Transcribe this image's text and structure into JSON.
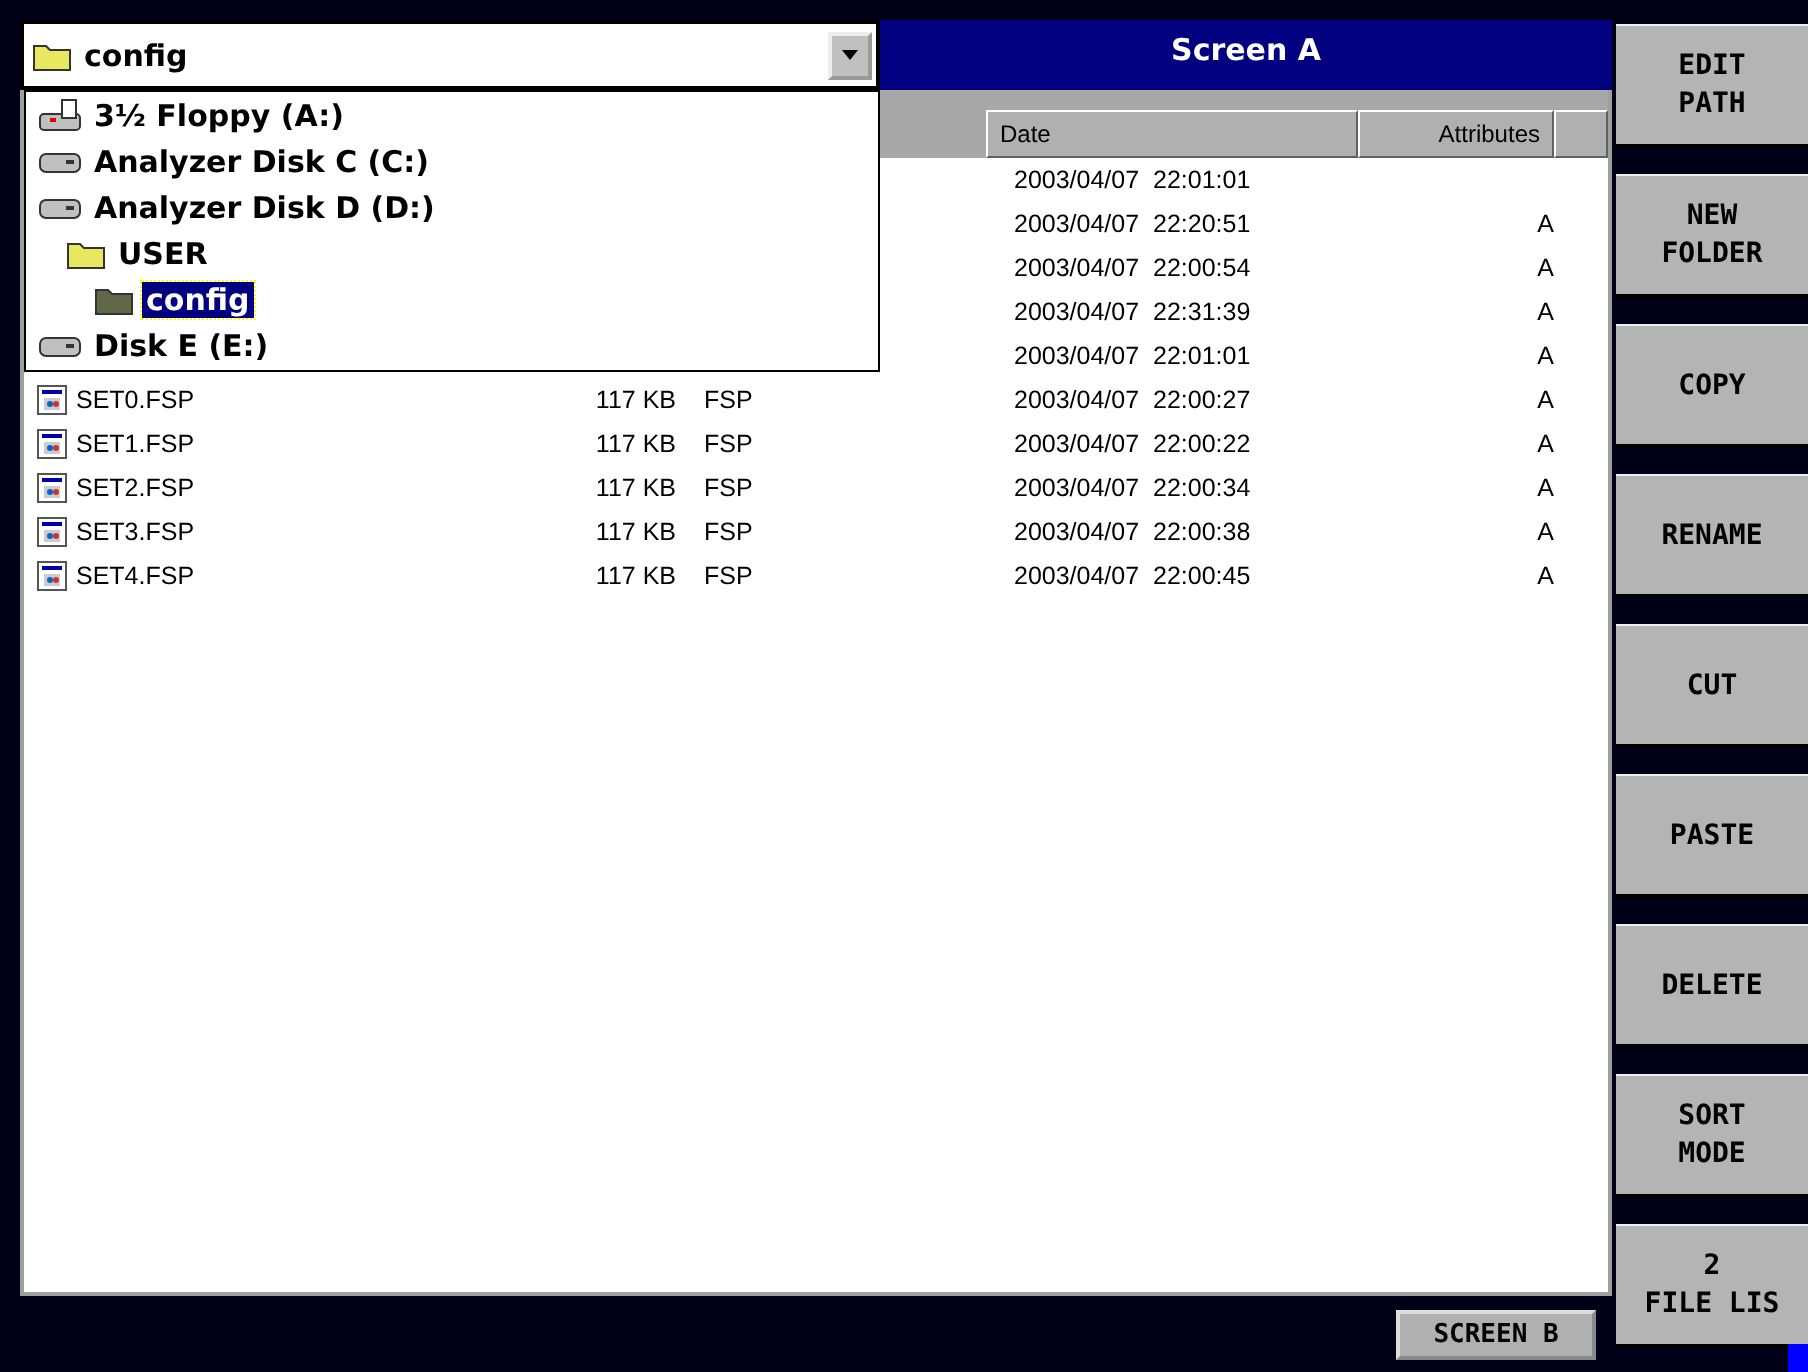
{
  "path_box": {
    "value": "config"
  },
  "title": "Screen A",
  "drive_list": [
    {
      "label": "3½ Floppy (A:)",
      "kind": "floppy",
      "selected": false
    },
    {
      "label": "Analyzer Disk C (C:)",
      "kind": "disk",
      "selected": false
    },
    {
      "label": "Analyzer Disk D (D:)",
      "kind": "disk",
      "selected": false,
      "children": [
        {
          "label": "USER",
          "kind": "folder",
          "selected": false,
          "children": [
            {
              "label": "config",
              "kind": "folder",
              "selected": true
            }
          ]
        }
      ]
    },
    {
      "label": "Disk E (E:)",
      "kind": "disk",
      "selected": false
    }
  ],
  "table": {
    "columns": [
      "Date",
      "Attributes"
    ],
    "rows": [
      {
        "date": "2003/04/07  22:01:01"
      },
      {
        "date": "2003/04/07  22:20:51",
        "attributes": "A"
      },
      {
        "date": "2003/04/07  22:00:54",
        "attributes": "A"
      },
      {
        "date": "2003/04/07  22:31:39",
        "attributes": "A"
      },
      {
        "date": "2003/04/07  22:01:01",
        "attributes": "A"
      },
      {
        "name": "SET0.FSP",
        "size": "117 KB",
        "type": "FSP",
        "date": "2003/04/07  22:00:27",
        "attributes": "A"
      },
      {
        "name": "SET1.FSP",
        "size": "117 KB",
        "type": "FSP",
        "date": "2003/04/07  22:00:22",
        "attributes": "A"
      },
      {
        "name": "SET2.FSP",
        "size": "117 KB",
        "type": "FSP",
        "date": "2003/04/07  22:00:34",
        "attributes": "A"
      },
      {
        "name": "SET3.FSP",
        "size": "117 KB",
        "type": "FSP",
        "date": "2003/04/07  22:00:38",
        "attributes": "A"
      },
      {
        "name": "SET4.FSP",
        "size": "117 KB",
        "type": "FSP",
        "date": "2003/04/07  22:00:45",
        "attributes": "A"
      }
    ]
  },
  "bottom_button": "SCREEN B",
  "softkeys": [
    {
      "lines": [
        "EDIT",
        "PATH"
      ]
    },
    {
      "lines": [
        "NEW",
        "FOLDER"
      ]
    },
    {
      "lines": [
        "COPY"
      ]
    },
    {
      "lines": [
        "RENAME"
      ]
    },
    {
      "lines": [
        "CUT"
      ]
    },
    {
      "lines": [
        "PASTE"
      ]
    },
    {
      "lines": [
        "DELETE"
      ]
    },
    {
      "lines": [
        "SORT",
        "MODE"
      ]
    },
    {
      "lines": [
        "2",
        "FILE LIS"
      ]
    }
  ]
}
